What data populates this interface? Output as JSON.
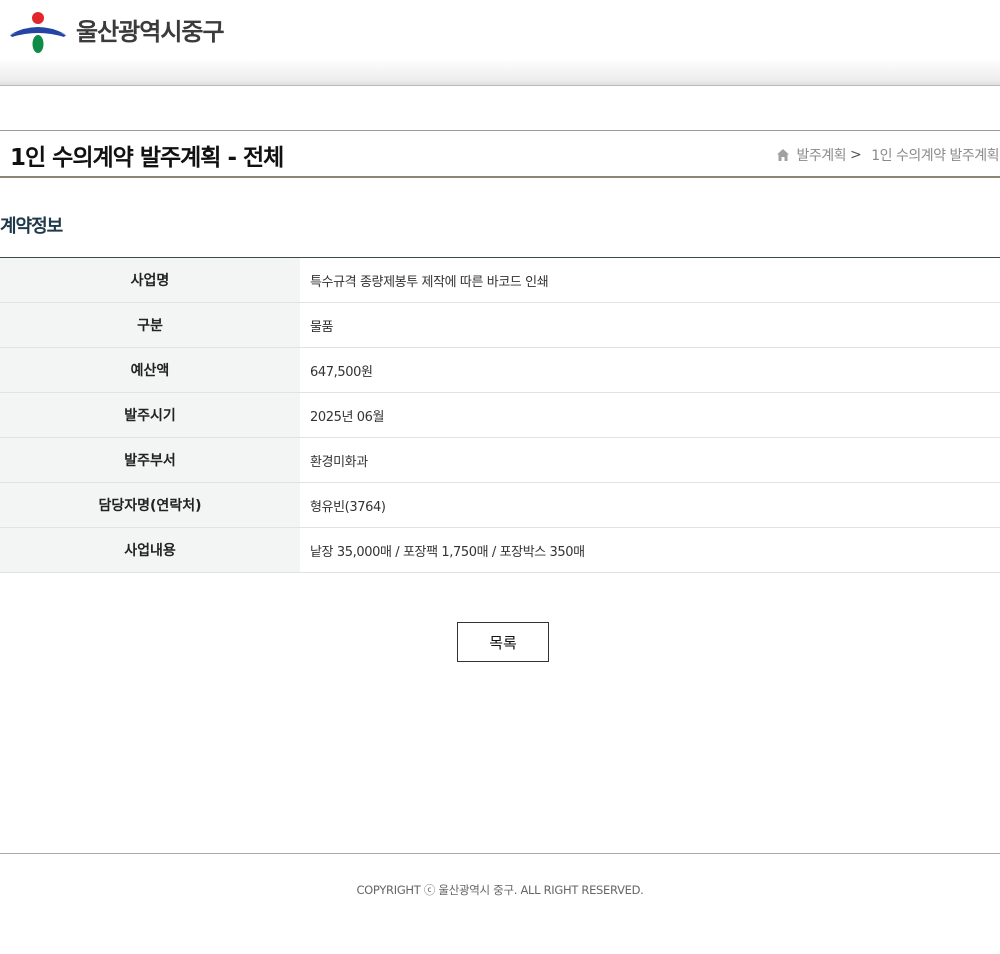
{
  "header": {
    "logo_text": "울산광역시중구",
    "logo_icon": "ulsan-junggu-emblem-icon"
  },
  "page": {
    "title": "1인 수의계약 발주계획 - 전체",
    "breadcrumb": {
      "home_icon": "home-icon",
      "items": [
        "발주계획",
        "1인 수의계약 발주계획"
      ],
      "separator": ">"
    }
  },
  "contract_info": {
    "section_title": "계약정보",
    "rows": [
      {
        "label": "사업명",
        "value": "특수규격 종량제봉투 제작에 따른 바코드 인쇄"
      },
      {
        "label": "구분",
        "value": "물품"
      },
      {
        "label": "예산액",
        "value": "647,500원"
      },
      {
        "label": "발주시기",
        "value": "2025년 06월"
      },
      {
        "label": "발주부서",
        "value": "환경미화과"
      },
      {
        "label": "담당자명(연락처)",
        "value": "형유빈(3764)"
      },
      {
        "label": "사업내용",
        "value": "낱장 35,000매 / 포장팩 1,750매 / 포장박스 350매"
      }
    ]
  },
  "actions": {
    "list_label": "목록"
  },
  "footer": {
    "copyright": "COPYRIGHT ⓒ 울산광역시 중구. ALL RIGHT RESERVED."
  },
  "colors": {
    "emblem_red": "#e3262c",
    "emblem_blue": "#2445a3",
    "emblem_green": "#0e8c45",
    "table_header_bg": "#f3f4f4",
    "section_title": "#1e3a4a"
  }
}
